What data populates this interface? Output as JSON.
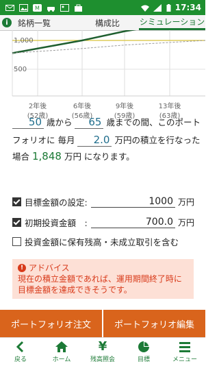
{
  "statusbar": {
    "time": "17:34"
  },
  "tabs": [
    "銘柄一覧",
    "構成比",
    "シミュレーション"
  ],
  "chart": {
    "y_labels": [
      "1,000",
      "500"
    ],
    "x_labels": [
      {
        "year": "2年後",
        "age": "(52歳)"
      },
      {
        "year": "6年後",
        "age": "(56歳)"
      },
      {
        "year": "9年後",
        "age": "(59歳)"
      },
      {
        "year": "13年後",
        "age": "(63歳)"
      }
    ]
  },
  "chart_data": {
    "type": "line",
    "x": [
      "2年後",
      "6年後",
      "9年後",
      "13年後"
    ],
    "series": [
      {
        "values": [
          780,
          1000,
          1160,
          1390
        ],
        "color": "#1e5e2e"
      },
      {
        "values": [
          780,
          860,
          920,
          1000
        ],
        "color": "#9a9a9a"
      }
    ],
    "target": 1000,
    "ylim": [
      400,
      1300
    ]
  },
  "simulation": {
    "start_age": "50",
    "from_label": "歳から",
    "end_age": "65",
    "until_label": "歳までの間、このポート",
    "line2_prefix": "フォリオに 毎月",
    "monthly": "2.0",
    "line2_suffix": "万円の積立を行なった",
    "line3_prefix": "場合",
    "result": "1,848",
    "line3_suffix": "万円 になります。"
  },
  "target": {
    "label": "目標金額の設定:",
    "value": "1000",
    "unit": "万円"
  },
  "initial": {
    "label": "初期投資金額　:",
    "value": "700.0",
    "unit": "万円"
  },
  "include": {
    "label": "投資金額に保有残高・未成立取引を含む"
  },
  "advice": {
    "title": "アドバイス",
    "body": "現在の積立金額であれば、運用期間終了時に目標金額を達成できそうです。"
  },
  "buttons": {
    "order": "ポートフォリオ注文",
    "edit": "ポートフォリオ編集"
  },
  "nav": [
    "戻る",
    "ホーム",
    "残高照会",
    "目標",
    "メニュー"
  ]
}
